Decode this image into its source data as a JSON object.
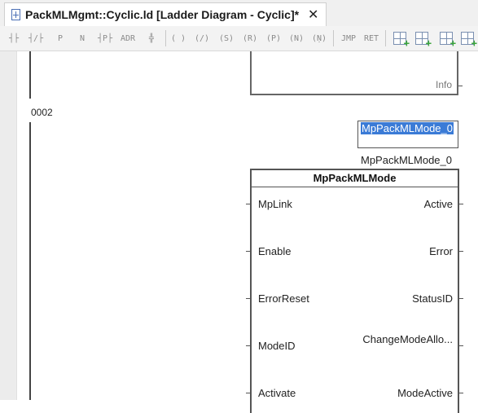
{
  "tab": {
    "title": "PackMLMgmt::Cyclic.ld [Ladder Diagram - Cyclic]*",
    "close_glyph": "✕"
  },
  "toolbar": {
    "buttons": [
      "contact-no",
      "contact-nc",
      "contact-p",
      "contact-n",
      "contact-pn",
      "contact-adr",
      "branch",
      "coil",
      "coil-negated",
      "coil-set",
      "coil-reset",
      "coil-p",
      "coil-n",
      "coil-pn",
      "jump",
      "return",
      "add-rung",
      "add-network",
      "insert-block",
      "add-block"
    ],
    "labels": {
      "contact_p": "P",
      "contact_n": "N",
      "contact_adr": "ADR",
      "coil": "( )",
      "coil_negated": "(/)",
      "coil_set": "(S)",
      "coil_reset": "(R)",
      "coil_p": "(P)",
      "coil_n": "(N)",
      "jump": "JMP",
      "return": "RET"
    }
  },
  "diagram": {
    "previous_block_output": "Info",
    "rung_number": "0002",
    "selected_variable": "MpPackMLMode_0",
    "instance_name": "MpPackMLMode_0",
    "function_block": {
      "type": "MpPackMLMode",
      "inputs": [
        "MpLink",
        "Enable",
        "ErrorReset",
        "ModeID",
        "Activate"
      ],
      "outputs": [
        "Active",
        "Error",
        "StatusID",
        "ChangeModeAllo...",
        "ModeActive"
      ]
    }
  }
}
